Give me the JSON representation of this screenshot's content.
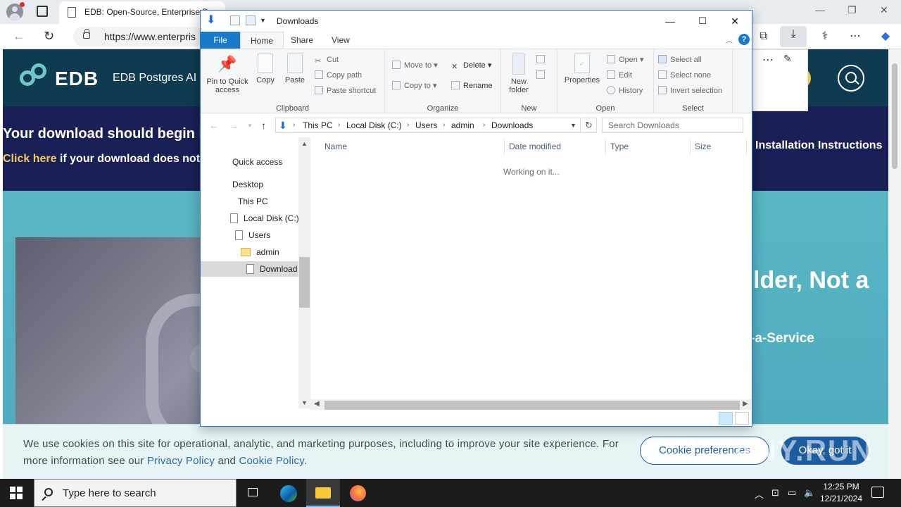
{
  "browser": {
    "tab_title": "EDB: Open-Source, Enterprise P",
    "address": "https://www.enterpris",
    "minimize": "—",
    "restore": "❐",
    "close": "✕"
  },
  "page": {
    "logo_text": "EDB",
    "nav_item": "EDB Postgres AI",
    "download_title": "Your download should begin i",
    "download_link": "Click here",
    "download_rest": " if your download does not st",
    "install_link": "Installation Instructions",
    "hero_title": "lder, Not a",
    "hero_sub": "-a-Service"
  },
  "cookie": {
    "text_before": "We use cookies on this site for operational, analytic, and marketing purposes, including to improve your site experience. For more information see our ",
    "privacy_link": "Privacy Policy",
    "and": " and ",
    "cookie_link": "Cookie Policy",
    "period": ".",
    "preferences_button": "Cookie preferences",
    "ok_button": "Okay, got it"
  },
  "watermark": "ANY.RUN",
  "explorer": {
    "title": "Downloads",
    "tabs": {
      "file": "File",
      "home": "Home",
      "share": "Share",
      "view": "View"
    },
    "clipboard": {
      "pin": "Pin to Quick access",
      "copy": "Copy",
      "paste": "Paste",
      "cut": "Cut",
      "copy_path": "Copy path",
      "paste_shortcut": "Paste shortcut",
      "label": "Clipboard"
    },
    "organize": {
      "move_to": "Move to",
      "copy_to": "Copy to",
      "delete": "Delete",
      "rename": "Rename",
      "label": "Organize"
    },
    "new": {
      "new_folder": "New folder",
      "label": "New"
    },
    "open": {
      "properties": "Properties",
      "open": "Open",
      "edit": "Edit",
      "history": "History",
      "label": "Open"
    },
    "select": {
      "select_all": "Select all",
      "select_none": "Select none",
      "invert": "Invert selection",
      "label": "Select"
    },
    "breadcrumbs": [
      "This PC",
      "Local Disk (C:)",
      "Users",
      "admin",
      "Downloads"
    ],
    "search_placeholder": "Search Downloads",
    "nav_items": [
      "Quick access",
      "Desktop",
      "This PC",
      "Local Disk (C:)",
      "Users",
      "admin",
      "Download"
    ],
    "columns": [
      "Name",
      "Date modified",
      "Type",
      "Size"
    ],
    "working_text": "Working on it..."
  },
  "taskbar": {
    "search_placeholder": "Type here to search",
    "time": "12:25 PM",
    "date": "12/21/2024"
  }
}
